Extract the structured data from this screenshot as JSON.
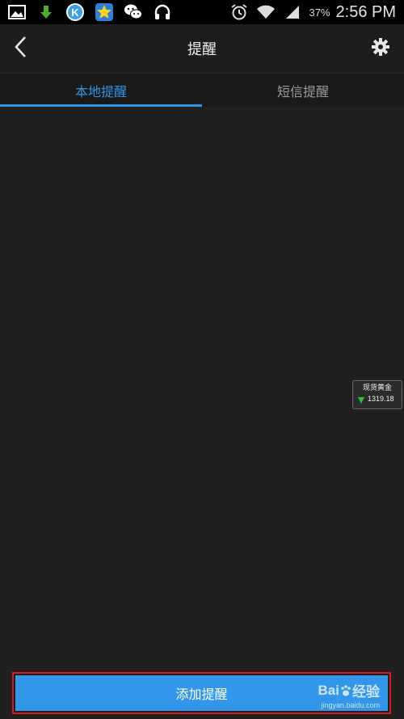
{
  "status_bar": {
    "icons": [
      "image-icon",
      "download-icon",
      "k-app-icon",
      "star-app-icon",
      "wechat-icon",
      "headphones-icon"
    ],
    "right_icons": [
      "alarm-icon",
      "wifi-icon",
      "signal-icon"
    ],
    "battery": "37%",
    "time": "2:56 PM"
  },
  "header": {
    "title": "提醒",
    "back_icon": "chevron-left-icon",
    "settings_icon": "gear-icon"
  },
  "tabs": [
    {
      "label": "本地提醒",
      "active": true
    },
    {
      "label": "短信提醒",
      "active": false
    }
  ],
  "float_widget": {
    "name": "现货黄金",
    "trend": "down",
    "price": "1319.18",
    "arrow_color": "#22c43a"
  },
  "bottom": {
    "add_label": "添加提醒"
  },
  "watermark": {
    "sub": "jingyan.baidu.com"
  },
  "colors": {
    "accent": "#2e95e6",
    "button": "#3296ea",
    "highlight_border": "#e0141c",
    "background": "#202020"
  }
}
